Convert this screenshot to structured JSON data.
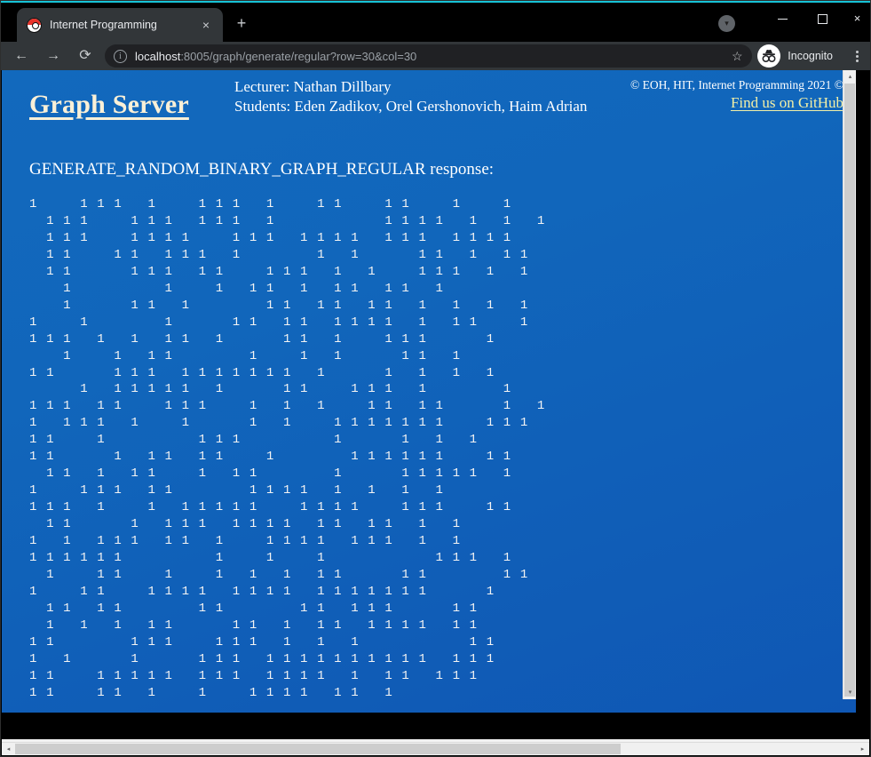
{
  "browser": {
    "tab": {
      "title": "Internet Programming",
      "favicon": "pokeball-icon",
      "close": "×"
    },
    "new_tab_label": "+",
    "tab_search_label": "▾",
    "window_controls": {
      "minimize": "minimize-icon",
      "maximize": "maximize-icon",
      "close": "×"
    },
    "nav": {
      "back": "←",
      "forward": "→",
      "reload": "⟳"
    },
    "omnibox": {
      "info_icon": "i",
      "url_host": "localhost",
      "url_rest": ":8005/graph/generate/regular?row=30&col=30",
      "full_url": "localhost:8005/graph/generate/regular?row=30&col=30",
      "bookmark_star": "☆"
    },
    "profile": {
      "label": "Incognito",
      "icon": "incognito-icon"
    },
    "menu_label": "⋮"
  },
  "page": {
    "site_title": "Graph Server",
    "lecturer_line": "Lecturer: Nathan Dillbary",
    "students_line": "Students: Eden Zadikov, Orel Gershonovich, Haim Adrian",
    "copyright": "© EOH, HIT, Internet Programming 2021 ©",
    "github_link": "Find us on GitHub",
    "response_title": "GENERATE_RANDOM_BINARY_GRAPH_REGULAR response:",
    "colors": {
      "background_top": "#1269bd",
      "background_bottom": "#0f57b4",
      "title": "#faf0d7",
      "link": "#f2efa6",
      "text": "#ffffff"
    }
  },
  "matrix": {
    "rows": 30,
    "cols": 30,
    "one_char": "1",
    "zero_char": " ",
    "grid": [
      [
        1,
        0,
        0,
        1,
        1,
        1,
        0,
        1,
        0,
        0,
        1,
        1,
        1,
        0,
        1,
        0,
        0,
        1,
        1,
        0,
        0,
        1,
        1,
        0,
        0,
        1,
        0,
        0,
        1,
        0
      ],
      [
        0,
        1,
        1,
        1,
        0,
        0,
        1,
        1,
        1,
        0,
        1,
        1,
        1,
        0,
        1,
        0,
        0,
        0,
        0,
        0,
        0,
        1,
        1,
        1,
        1,
        0,
        1,
        0,
        1,
        0,
        1
      ],
      [
        0,
        1,
        1,
        1,
        0,
        0,
        1,
        1,
        1,
        1,
        0,
        0,
        1,
        1,
        1,
        0,
        1,
        1,
        1,
        1,
        0,
        1,
        1,
        1,
        0,
        1,
        1,
        1,
        1,
        0
      ],
      [
        0,
        1,
        1,
        0,
        0,
        1,
        1,
        0,
        1,
        1,
        1,
        0,
        1,
        0,
        0,
        0,
        0,
        1,
        0,
        1,
        0,
        0,
        0,
        1,
        1,
        0,
        1,
        0,
        1,
        1
      ],
      [
        0,
        1,
        1,
        0,
        0,
        0,
        1,
        1,
        1,
        0,
        1,
        1,
        0,
        0,
        1,
        1,
        1,
        0,
        1,
        0,
        1,
        0,
        0,
        1,
        1,
        1,
        0,
        1,
        0,
        1
      ],
      [
        0,
        0,
        1,
        0,
        0,
        0,
        0,
        0,
        1,
        0,
        0,
        1,
        0,
        1,
        1,
        0,
        1,
        0,
        1,
        1,
        0,
        1,
        1,
        0,
        1,
        0,
        0,
        0,
        0,
        0
      ],
      [
        0,
        0,
        1,
        0,
        0,
        0,
        1,
        1,
        0,
        1,
        0,
        0,
        0,
        0,
        1,
        1,
        0,
        1,
        1,
        0,
        1,
        1,
        0,
        1,
        0,
        1,
        0,
        1,
        0,
        1
      ],
      [
        1,
        0,
        0,
        1,
        0,
        0,
        0,
        0,
        1,
        0,
        0,
        0,
        1,
        1,
        0,
        1,
        1,
        0,
        1,
        1,
        1,
        1,
        0,
        1,
        0,
        1,
        1,
        0,
        0,
        1
      ],
      [
        1,
        1,
        1,
        0,
        1,
        0,
        1,
        0,
        1,
        1,
        0,
        1,
        0,
        0,
        0,
        1,
        1,
        0,
        1,
        0,
        0,
        1,
        1,
        1,
        0,
        0,
        0,
        1,
        0,
        0
      ],
      [
        0,
        0,
        1,
        0,
        0,
        1,
        0,
        1,
        1,
        0,
        0,
        0,
        0,
        1,
        0,
        0,
        1,
        0,
        1,
        0,
        0,
        0,
        1,
        1,
        0,
        1,
        0,
        0,
        0,
        0
      ],
      [
        1,
        1,
        0,
        0,
        0,
        1,
        1,
        1,
        0,
        1,
        1,
        1,
        1,
        1,
        1,
        1,
        0,
        1,
        0,
        0,
        0,
        1,
        0,
        1,
        0,
        1,
        0,
        1,
        0,
        0
      ],
      [
        0,
        0,
        0,
        1,
        0,
        1,
        1,
        1,
        1,
        1,
        0,
        1,
        0,
        0,
        0,
        1,
        1,
        0,
        0,
        1,
        1,
        1,
        0,
        1,
        0,
        0,
        0,
        0,
        1,
        0
      ],
      [
        1,
        1,
        1,
        0,
        1,
        1,
        0,
        0,
        1,
        1,
        1,
        0,
        0,
        1,
        0,
        1,
        0,
        1,
        0,
        0,
        1,
        1,
        0,
        1,
        1,
        0,
        0,
        0,
        1,
        0,
        1
      ],
      [
        1,
        0,
        1,
        1,
        1,
        0,
        1,
        0,
        0,
        1,
        0,
        0,
        0,
        1,
        0,
        1,
        0,
        0,
        1,
        1,
        1,
        1,
        1,
        1,
        1,
        0,
        0,
        1,
        1,
        1
      ],
      [
        1,
        1,
        0,
        0,
        1,
        0,
        0,
        0,
        0,
        0,
        1,
        1,
        1,
        0,
        0,
        0,
        0,
        0,
        1,
        0,
        0,
        0,
        1,
        0,
        1,
        0,
        1,
        0,
        0,
        0
      ],
      [
        1,
        1,
        0,
        0,
        0,
        1,
        0,
        1,
        1,
        0,
        1,
        1,
        0,
        0,
        1,
        0,
        0,
        0,
        0,
        1,
        1,
        1,
        1,
        1,
        1,
        0,
        0,
        1,
        1,
        0
      ],
      [
        0,
        1,
        1,
        0,
        1,
        0,
        1,
        1,
        0,
        0,
        1,
        0,
        1,
        1,
        0,
        0,
        0,
        0,
        1,
        0,
        0,
        0,
        1,
        1,
        1,
        1,
        1,
        0,
        1,
        0
      ],
      [
        1,
        0,
        0,
        1,
        1,
        1,
        0,
        1,
        1,
        0,
        0,
        0,
        0,
        1,
        1,
        1,
        1,
        0,
        1,
        0,
        1,
        0,
        1,
        0,
        1,
        0,
        0,
        0,
        0,
        0
      ],
      [
        1,
        1,
        1,
        0,
        1,
        0,
        0,
        1,
        0,
        1,
        1,
        1,
        1,
        1,
        0,
        0,
        1,
        1,
        1,
        1,
        0,
        0,
        1,
        1,
        1,
        0,
        0,
        1,
        1,
        0
      ],
      [
        0,
        1,
        1,
        0,
        0,
        0,
        1,
        0,
        1,
        1,
        1,
        0,
        1,
        1,
        1,
        1,
        0,
        1,
        1,
        0,
        1,
        1,
        0,
        1,
        0,
        1,
        0,
        0,
        0,
        0
      ],
      [
        1,
        0,
        1,
        0,
        1,
        1,
        1,
        0,
        1,
        1,
        0,
        1,
        0,
        0,
        1,
        1,
        1,
        1,
        0,
        1,
        1,
        1,
        0,
        1,
        0,
        1,
        0,
        0,
        0,
        0
      ],
      [
        1,
        1,
        1,
        1,
        1,
        1,
        0,
        0,
        0,
        0,
        0,
        1,
        0,
        0,
        1,
        0,
        0,
        1,
        0,
        0,
        0,
        0,
        0,
        0,
        1,
        1,
        1,
        0,
        1,
        0
      ],
      [
        0,
        1,
        0,
        0,
        1,
        1,
        0,
        0,
        1,
        0,
        0,
        1,
        0,
        1,
        0,
        1,
        0,
        1,
        1,
        0,
        0,
        0,
        1,
        1,
        0,
        0,
        0,
        0,
        1,
        1
      ],
      [
        1,
        0,
        0,
        1,
        1,
        0,
        0,
        1,
        1,
        1,
        1,
        0,
        1,
        1,
        1,
        1,
        0,
        1,
        1,
        1,
        1,
        1,
        1,
        1,
        0,
        0,
        0,
        1,
        0,
        0
      ],
      [
        0,
        1,
        1,
        0,
        1,
        1,
        0,
        0,
        0,
        0,
        1,
        1,
        0,
        0,
        0,
        0,
        1,
        1,
        0,
        1,
        1,
        1,
        0,
        0,
        0,
        1,
        1,
        0,
        0,
        0
      ],
      [
        0,
        1,
        0,
        1,
        0,
        1,
        0,
        1,
        1,
        0,
        0,
        0,
        1,
        1,
        0,
        1,
        0,
        1,
        1,
        0,
        1,
        1,
        1,
        1,
        0,
        1,
        1,
        0,
        0,
        0
      ],
      [
        1,
        1,
        0,
        0,
        0,
        0,
        1,
        1,
        1,
        0,
        0,
        1,
        1,
        1,
        0,
        1,
        0,
        1,
        0,
        1,
        0,
        0,
        0,
        0,
        0,
        0,
        1,
        1,
        0,
        0
      ],
      [
        1,
        0,
        1,
        0,
        0,
        0,
        1,
        0,
        0,
        0,
        1,
        1,
        1,
        0,
        1,
        1,
        1,
        1,
        1,
        1,
        1,
        1,
        1,
        1,
        0,
        1,
        1,
        1,
        0,
        0
      ],
      [
        1,
        1,
        0,
        0,
        1,
        1,
        1,
        1,
        1,
        0,
        1,
        1,
        1,
        0,
        1,
        1,
        1,
        1,
        0,
        1,
        0,
        1,
        1,
        0,
        1,
        1,
        1,
        0,
        0,
        0
      ],
      [
        1,
        1,
        0,
        0,
        1,
        1,
        0,
        1,
        0,
        0,
        1,
        0,
        0,
        1,
        1,
        1,
        1,
        0,
        1,
        1,
        0,
        1,
        0,
        0,
        0,
        0,
        0,
        0,
        0,
        0
      ]
    ]
  },
  "scrollbars": {
    "vertical": {
      "up": "▴",
      "down": "▾"
    },
    "horizontal": {
      "left": "◂",
      "right": "▸"
    }
  }
}
